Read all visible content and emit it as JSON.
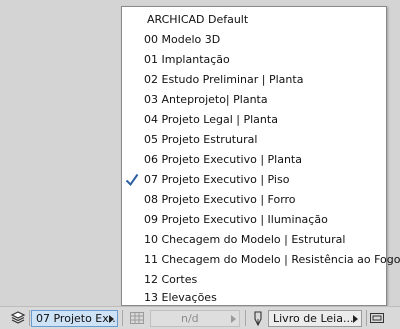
{
  "layer_menu": {
    "items": [
      {
        "label": "ARCHICAD Default",
        "checked": false
      },
      {
        "label": "00 Modelo 3D",
        "checked": false
      },
      {
        "label": "01 Implantação",
        "checked": false
      },
      {
        "label": "02 Estudo Preliminar | Planta",
        "checked": false
      },
      {
        "label": "03 Anteprojeto| Planta",
        "checked": false
      },
      {
        "label": "04 Projeto Legal | Planta",
        "checked": false
      },
      {
        "label": "05 Projeto Estrutural",
        "checked": false
      },
      {
        "label": "06 Projeto Executivo | Planta",
        "checked": false
      },
      {
        "label": "07 Projeto Executivo | Piso",
        "checked": true
      },
      {
        "label": "08 Projeto Executivo | Forro",
        "checked": false
      },
      {
        "label": "09 Projeto Executivo | Iluminação",
        "checked": false
      },
      {
        "label": "10 Checagem do Modelo | Estrutural",
        "checked": false
      },
      {
        "label": "11 Checagem do Modelo | Resistência ao Fogo",
        "checked": false
      },
      {
        "label": "12 Cortes",
        "checked": false
      },
      {
        "label": "13 Elevações",
        "checked": false
      }
    ]
  },
  "statusbar": {
    "layer_combo": "07 Projeto Ex...",
    "nd_combo": "n/d",
    "pen_combo": "Livro de Leia..."
  },
  "colors": {
    "active_combo": "#cfe3f7",
    "check": "#2d5fa3"
  }
}
